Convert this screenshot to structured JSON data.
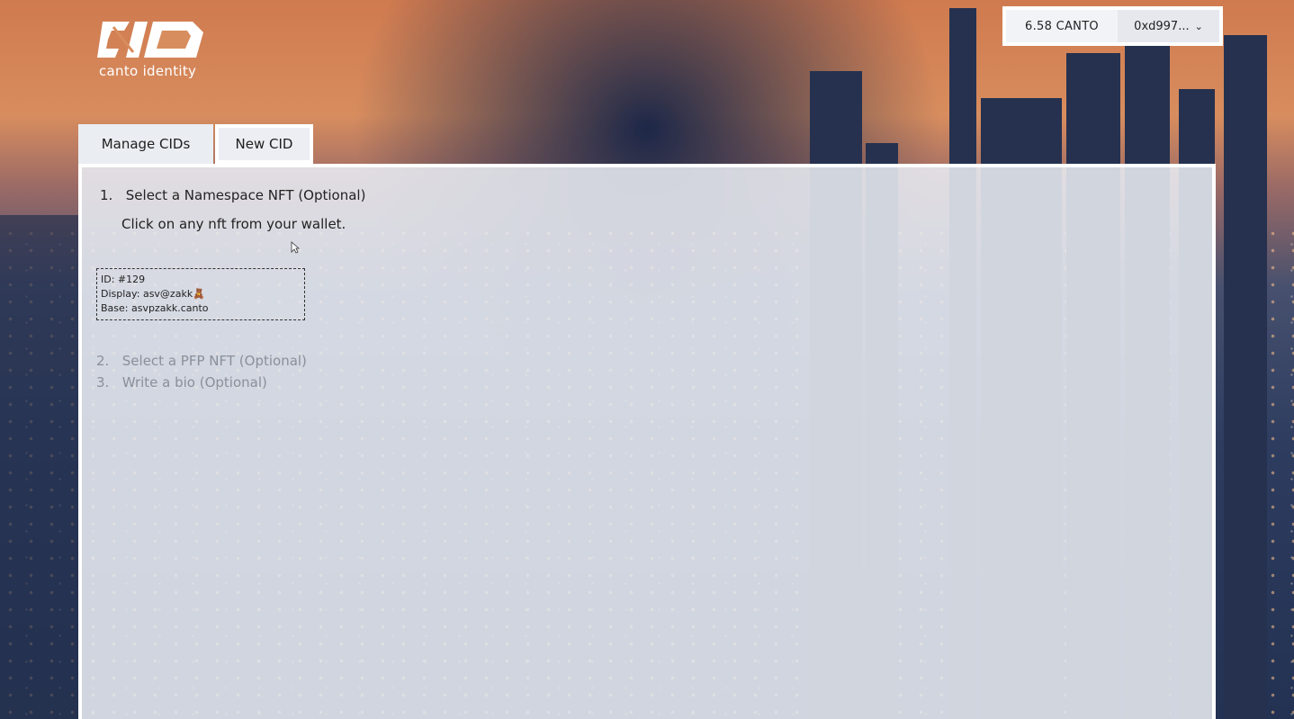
{
  "brand": {
    "logo_text": "canto identity"
  },
  "wallet": {
    "balance": "6.58 CANTO",
    "address": "0xd997..."
  },
  "tabs": [
    {
      "label": "Manage CIDs",
      "active": false
    },
    {
      "label": "New CID",
      "active": true
    }
  ],
  "steps": {
    "step1": {
      "number": "1.",
      "label": "Select a Namespace NFT (Optional)",
      "hint": "Click on any nft from your wallet."
    },
    "nft": {
      "id_line": "ID: #129",
      "display_line": "Display: asv@zakk🧸",
      "base_line": "Base: asvpzakk.canto"
    },
    "step2": {
      "number": "2.",
      "label": "Select a PFP NFT (Optional)"
    },
    "step3": {
      "number": "3.",
      "label": "Write a bio (Optional)"
    }
  },
  "icons": {
    "logo": "cid-logo-icon",
    "chevron": "chevron-down-icon",
    "cursor": "mouse-cursor-icon"
  }
}
